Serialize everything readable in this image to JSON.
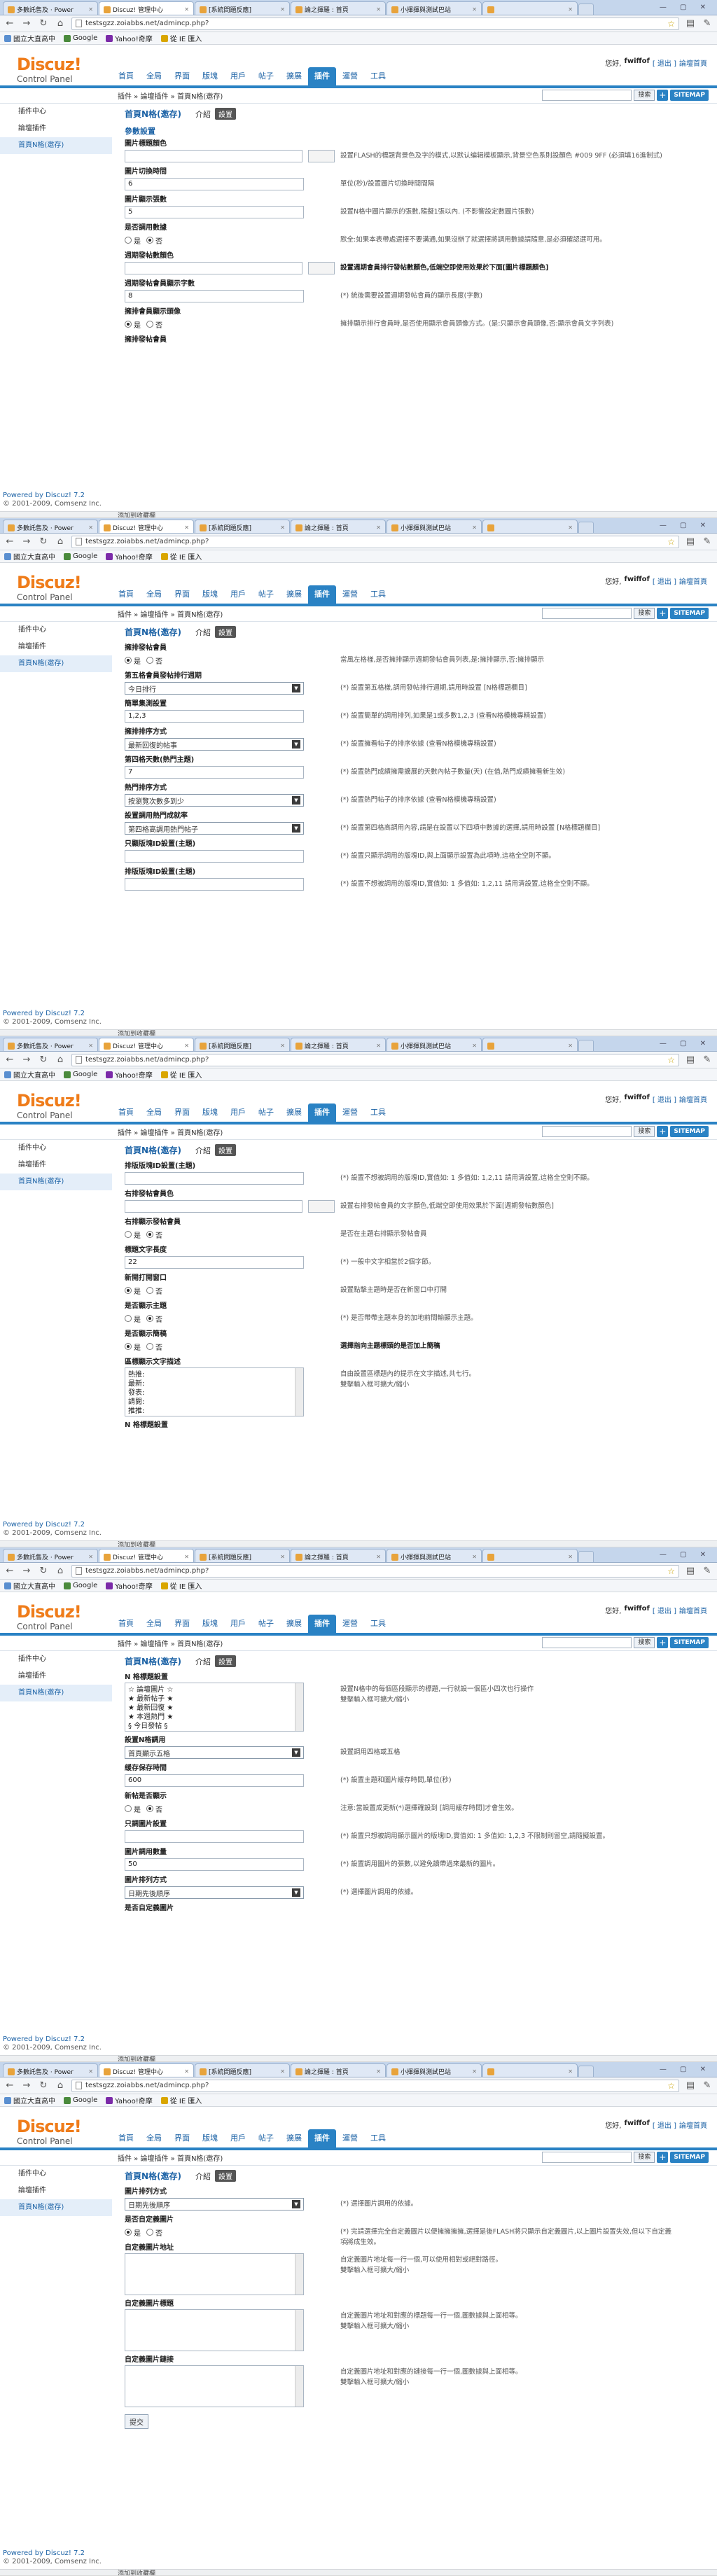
{
  "browser": {
    "tabs": [
      "多數託售及 · Power",
      "Discuz! 管理中心",
      "[系統問題反應]",
      "論之揮羅 : 首頁",
      "小揮揮與測試巴站",
      ""
    ],
    "url": "testsgzz.zoiabbs.net/admincp.php?",
    "window_controls": "— ▢ ✕",
    "bookmarks": [
      {
        "label": "國立大直高中",
        "color": "#5a8fd0"
      },
      {
        "label": "Google",
        "color": "#4a8a3c"
      },
      {
        "label": "Yahoo!奇摩",
        "color": "#7b2aa8"
      },
      {
        "label": "從 IE 匯入",
        "color": "#d9a600"
      }
    ]
  },
  "header": {
    "logo_main": "Discuz!",
    "logo_sub": "Control Panel",
    "menu": [
      "首頁",
      "全局",
      "界面",
      "版塊",
      "用戶",
      "帖子",
      "擴展",
      "插件",
      "運營",
      "工具"
    ],
    "active_menu": "插件",
    "user": {
      "greet": "您好,",
      "name": "fwiffof",
      "logout": "[ 退出 ]",
      "home": "論壇首頁"
    }
  },
  "crumb": "插件 » 論壇插件 » 首頁N格(邀存)",
  "search": {
    "button": "搜索",
    "plus": "+",
    "sitemap": "SITEMAP"
  },
  "sidebar": {
    "items": [
      "插件中心",
      "論壇插件",
      "首頁N格(邀存)"
    ],
    "powered_prefix": "Powered by ",
    "powered_link": "Discuz! 7.2",
    "copyright": "© 2001-2009, Comsenz Inc.",
    "footer_link": "添加到收藏欄"
  },
  "pagehead": {
    "title": "首頁N格(邀存)",
    "intro": "介紹",
    "settings": "設置"
  },
  "screens": [
    {
      "section": "參數設置",
      "fields": [
        {
          "label": "圖片標題顏色",
          "type": "color",
          "value": "",
          "note": "設置FLASH的標題背景色及字的模式,以默认编辑模板顯示,背景空色系則設顏色 #009 9FF (必須填16進制式)"
        },
        {
          "label": "圖片切換時間",
          "type": "text",
          "value": "6",
          "note": "單位(秒)/設置圖片切換時間間隔"
        },
        {
          "label": "圖片顯示張數",
          "type": "text",
          "value": "5",
          "note": "設置N格中圖片顯示的張數,隨擬1張以內. (不影響設定數圖片張數)"
        },
        {
          "label": "是否調用數據",
          "type": "radio",
          "options": [
            "是",
            "否"
          ],
          "selected": 1,
          "note": "默全:如果本表帶處選擇不要溝通,如果沒辦了就選擇將調用數據請隨意,是必須確認選可用。"
        },
        {
          "label": "週期發帖數顏色",
          "type": "color",
          "value": "",
          "note": "設置週期會員排行發帖數顏色,低端空即使用效果於下面[圖片標題顏色]",
          "bold": true
        },
        {
          "label": "週期發帖會員顯示字數",
          "type": "text",
          "value": "8",
          "note": "(*) 統後需要設置週期發帖會員的顯示長度(字數)"
        },
        {
          "label": "擁排會員顯示頭像",
          "type": "radio",
          "options": [
            "是",
            "否"
          ],
          "selected": 0,
          "note": "擁排顯示排行會員時,是否使用顯示會員頭像方式。(是:只顯示會員頭像,否:顯示會員文字列表)"
        },
        {
          "label": "擁排發帖會員",
          "type": "none",
          "value": "",
          "note": ""
        }
      ]
    },
    {
      "section": "",
      "fields": [
        {
          "label": "擁排發帖會員",
          "type": "radio",
          "options": [
            "是",
            "否"
          ],
          "selected": 0,
          "note": "當風左格樣,是否擁排顯示週期發帖會員列表,是:擁排顯示,否:擁排顯示"
        },
        {
          "label": "第五格會員發帖排行週期",
          "type": "select",
          "value": "今日排行",
          "note": "(*) 設置第五格樣,調用發帖排行週期,請用時設置 [N格標題欄目]"
        },
        {
          "label": "簡單集測設置",
          "type": "text",
          "value": "1,2,3",
          "note": "(*) 設置簡單的調用排列,如果是1或多數1,2,3 (查看N格模機專精設置)"
        },
        {
          "label": "擁排排序方式",
          "type": "select",
          "value": "最新回復的帖事",
          "note": "(*) 設置擁看帖子的排序依據 (查看N格模機專精設置)"
        },
        {
          "label": "第四格天數(熱門主題)",
          "type": "text",
          "value": "7",
          "note": "(*) 設置熱門成績擁需擴展的天數內帖子數量(天) (在值,熱門成績擁看新生效)"
        },
        {
          "label": "熱門排序方式",
          "type": "select",
          "value": "按瀏覽次數多到少",
          "note": "(*) 設置熱門帖子的排序依據 (查看N格模機專精設置)"
        },
        {
          "label": "設置調用熱門成就率",
          "type": "select",
          "value": "第四格高調用熱門帖子",
          "note": "(*) 設置第四格高調用內容,請是在設置以下四項中數據的選擇,請用時設置 [N格標題欄目]"
        },
        {
          "label": "只顯版塊ID設置(主題)",
          "type": "text",
          "value": "",
          "note": "(*) 設置只顯示調用的版塊ID,與上面顯示設置為此項時,這格全空則不顯。"
        },
        {
          "label": "排版版塊ID設置(主題)",
          "type": "text",
          "value": "",
          "note": "(*) 設置不想被調用的版塊ID,實值如: 1 多值如: 1,2,11 請用清設置,這格全空則不顯。"
        }
      ]
    },
    {
      "section": "",
      "fields": [
        {
          "label": "排版版塊ID設置(主題)",
          "type": "text",
          "value": "",
          "note": "(*) 設置不想被調用的版塊ID,實值如: 1 多值如: 1,2,11 請用清設置,這格全空則不顯。"
        },
        {
          "label": "右排發帖會員色",
          "type": "color",
          "value": "",
          "note": "設置右排發帖會員的文字顏色,低端空即使用效果於下面[週期發帖數顏色]"
        },
        {
          "label": "右排顯示發帖會員",
          "type": "radio",
          "options": [
            "是",
            "否"
          ],
          "selected": 1,
          "note": "是否在主題右排顯示發帖會員"
        },
        {
          "label": "標題文字長度",
          "type": "text",
          "value": "22",
          "note": "(*) 一般中文字相當於2個字節。"
        },
        {
          "label": "新開打開窗口",
          "type": "radio",
          "options": [
            "是",
            "否"
          ],
          "selected": 0,
          "note": "設置點擊主題時是否在新窗口中打開"
        },
        {
          "label": "是否顯示主題",
          "type": "radio",
          "options": [
            "是",
            "否"
          ],
          "selected": 1,
          "note": "(*) 是否帶帶主題本身的加地前間輸顯示主題。"
        },
        {
          "label": "是否顯示簡稿",
          "type": "radio",
          "options": [
            "是",
            "否"
          ],
          "selected": 0,
          "note": "選擇指向主題標頭的是否加上簡稿",
          "bold": true
        },
        {
          "label": "區標顯示文字描述",
          "type": "textarea",
          "value": "熱推:\n最新:\n發表:\n請閱:\n推推:\n最新回復:",
          "note": "自由設置區標題內的提示在文字描述,共七行。\n雙擊輸入框可擴大/縮小"
        },
        {
          "label": "N 格標題設置",
          "type": "none",
          "value": "",
          "note": ""
        }
      ]
    },
    {
      "section": "",
      "fields": [
        {
          "label": "N 格標題設置",
          "type": "textarea",
          "value": "☆ 論壇圖片 ☆\n★ 最新帖子 ★\n★ 最新回復 ★\n★ 本週熱門 ★\n§ 今日發帖 §",
          "note": "設置N格中的每個區段顯示的標題,一行就設一個區小四次也行操作\n雙擊輸入框可擴大/縮小"
        },
        {
          "label": "設置N格調用",
          "type": "select",
          "value": "首頁顯示五格",
          "note": "設置調用四格或五格"
        },
        {
          "label": "緩存保存時間",
          "type": "text",
          "value": "600",
          "note": "(*) 設置主題和圖片緩存時間,單位(秒)"
        },
        {
          "label": "新帖是否顯示",
          "type": "radio",
          "options": [
            "是",
            "否"
          ],
          "selected": 1,
          "note": "注意:當設置成更新(*)選擇確設到 [調用緩存時間]才會生效。"
        },
        {
          "label": "只調圖片設置",
          "type": "text",
          "value": "",
          "note": "(*) 設置只想被調用顯示圖片的版塊ID,實值如: 1 多值如: 1,2,3 不限制則留空,請隨擬設置。"
        },
        {
          "label": "圖片調用數量",
          "type": "text",
          "value": "50",
          "note": "(*) 設置調用圖片的張數,以避免讀帶過來最新的圖片。"
        },
        {
          "label": "圖片排列方式",
          "type": "select",
          "value": "日期先後順序",
          "note": "(*) 選擇圖片調用的依據。"
        },
        {
          "label": "是否自定義圖片",
          "type": "none",
          "value": "",
          "note": ""
        }
      ]
    },
    {
      "section": "",
      "fields": [
        {
          "label": "圖片排列方式",
          "type": "select",
          "value": "日期先後順序",
          "note": "(*) 選擇圖片調用的依據。"
        },
        {
          "label": "是否自定義圖片",
          "type": "radio",
          "options": [
            "是",
            "否"
          ],
          "selected": 0,
          "note": "(*) 完請選擇完全自定義圖片以便擁擁擁擁,選擇是後FLASH將只顯示自定義圖片,以上圖片設置失效,但以下自定義項將成生效。"
        },
        {
          "label": "自定義圖片地址",
          "type": "textarea",
          "value": "",
          "note": "自定義圖片地址每一行一個,可以使用相對或絕對路徑。\n雙擊輸入框可擴大/縮小"
        },
        {
          "label": "自定義圖片標題",
          "type": "textarea",
          "value": "",
          "note": "自定義圖片地址和對應的標題每一行一個,圖數據與上面相等。\n雙擊輸入框可擴大/縮小"
        },
        {
          "label": "自定義圖片鏈接",
          "type": "textarea",
          "value": "",
          "note": "自定義圖片地址和對應的鏈接每一行一個,圖數據與上面相等。\n雙擊輸入框可擴大/縮小"
        }
      ],
      "submit": "提交"
    }
  ]
}
